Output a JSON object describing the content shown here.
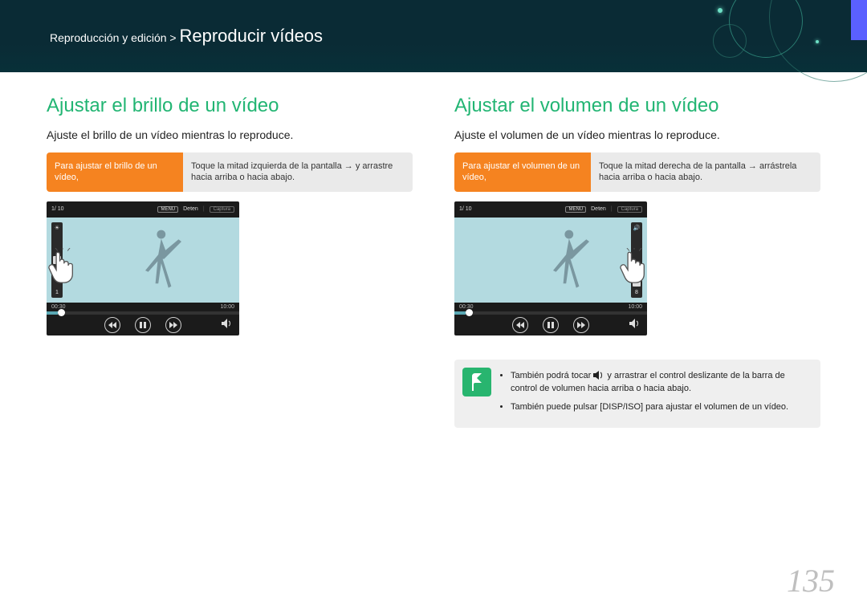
{
  "header": {
    "breadcrumb": "Reproducción y edición > ",
    "title": "Reproducir vídeos"
  },
  "left": {
    "heading": "Ajustar el brillo de un vídeo",
    "desc": "Ajuste el brillo de un vídeo mientras lo reproduce.",
    "label": "Para ajustar el brillo de un vídeo,",
    "instr": "Toque la mitad izquierda de la pantalla → y arrastre hacia arriba o hacia abajo."
  },
  "right": {
    "heading": "Ajustar el volumen de un vídeo",
    "desc": "Ajuste el volumen de un vídeo mientras lo reproduce.",
    "label": "Para ajustar el volumen de un vídeo,",
    "instr": "Toque la mitad derecha de la pantalla → arrástrela hacia arriba o hacia abajo."
  },
  "player": {
    "count": "1/ 10",
    "menu": "MENU",
    "stop": "Deten",
    "capture": "Captura",
    "t0": "00:30",
    "t1": "10:00",
    "slider_top_b": "☀",
    "slider_bot_b": "1",
    "slider_top_v": "🔊",
    "slider_bot_v": "8"
  },
  "note": {
    "l1a": "También podrá tocar ",
    "l1b": " y arrastrar el control deslizante de la barra de control de volumen hacia arriba o hacia abajo.",
    "l2a": "También puede pulsar [",
    "l2b": "DISP/ISO",
    "l2c": "] para ajustar el volumen de un vídeo."
  },
  "pagenum": "135"
}
